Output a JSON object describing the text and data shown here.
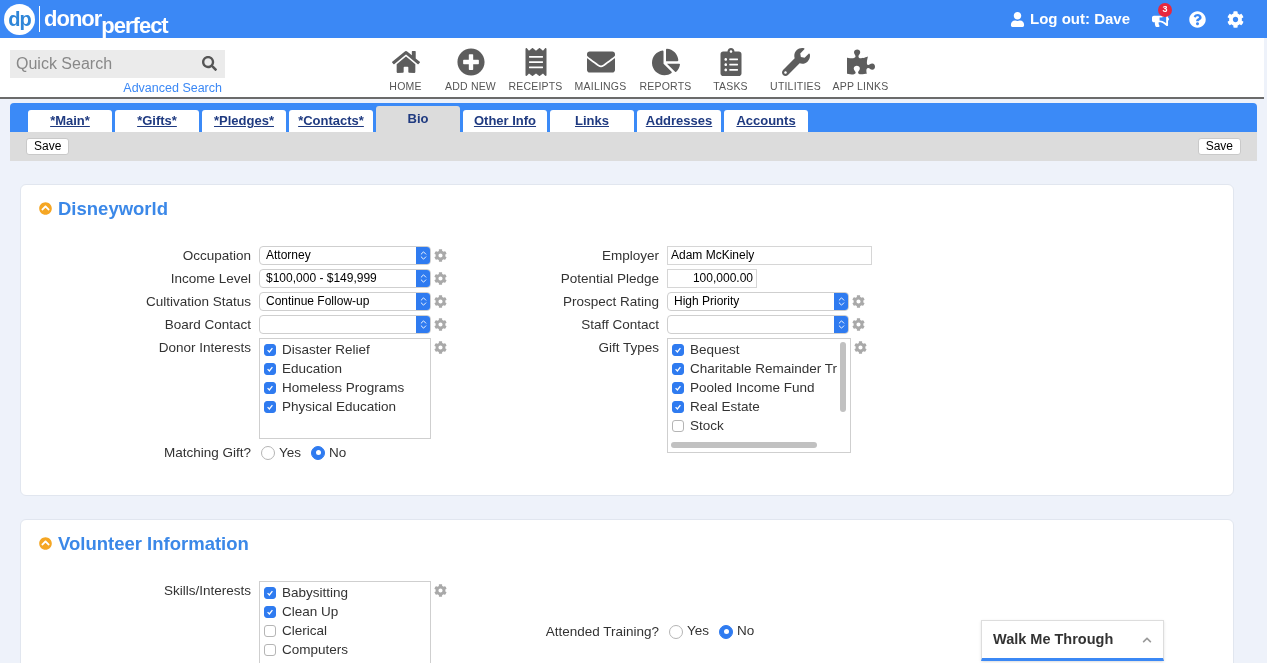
{
  "header": {
    "logo_mark": "dp",
    "logo_word_1": "donor",
    "logo_word_2": "perfect",
    "user": "Log out: Dave",
    "notification_count": "3"
  },
  "search": {
    "placeholder": "Quick Search",
    "advanced_link": "Advanced Search"
  },
  "nav": [
    "HOME",
    "ADD NEW",
    "RECEIPTS",
    "MAILINGS",
    "REPORTS",
    "TASKS",
    "UTILITIES",
    "APP LINKS"
  ],
  "tabs": [
    {
      "label": "*Main*",
      "selected": false
    },
    {
      "label": "*Gifts*",
      "selected": false
    },
    {
      "label": "*Pledges*",
      "selected": false
    },
    {
      "label": "*Contacts*",
      "selected": false
    },
    {
      "label": "Bio",
      "selected": true
    },
    {
      "label": "Other Info",
      "selected": false
    },
    {
      "label": "Links",
      "selected": false
    },
    {
      "label": "Addresses",
      "selected": false
    },
    {
      "label": "Accounts",
      "selected": false
    }
  ],
  "toolbar": {
    "save_left": "Save",
    "save_right": "Save"
  },
  "sections": [
    {
      "title": "Disneyworld",
      "expanded": true,
      "left": [
        {
          "kind": "select",
          "label": "Occupation",
          "value": "Attorney",
          "configurable": true
        },
        {
          "kind": "select",
          "label": "Income Level",
          "value": "$100,000 - $149,999",
          "configurable": true
        },
        {
          "kind": "select",
          "label": "Cultivation Status",
          "value": "Continue Follow-up",
          "configurable": true
        },
        {
          "kind": "select",
          "label": "Board Contact",
          "configurable": true
        },
        {
          "kind": "checklist",
          "label": "Donor Interests",
          "configurable": true,
          "scrollbars": false,
          "items": [
            {
              "label": "Disaster Relief",
              "checked": true
            },
            {
              "label": "Education",
              "checked": true
            },
            {
              "label": "Homeless Programs",
              "checked": true
            },
            {
              "label": "Physical Education",
              "checked": true
            }
          ]
        },
        {
          "kind": "radio",
          "label": "Matching Gift?",
          "options": [
            {
              "label": "Yes",
              "selected": false
            },
            {
              "label": "No",
              "selected": true
            }
          ]
        }
      ],
      "right": [
        {
          "kind": "text",
          "label": "Employer",
          "value": "Adam McKinely",
          "configurable": false
        },
        {
          "kind": "number",
          "label": "Potential Pledge",
          "value": "100,000.00",
          "configurable": false
        },
        {
          "kind": "select",
          "label": "Prospect Rating",
          "value": "High Priority",
          "configurable": true
        },
        {
          "kind": "select",
          "label": "Staff Contact",
          "configurable": true
        },
        {
          "kind": "checklist",
          "label": "Gift Types",
          "configurable": true,
          "scrollbars": true,
          "items": [
            {
              "label": "Bequest",
              "checked": true
            },
            {
              "label": "Charitable Remainder Tr",
              "checked": true
            },
            {
              "label": "Pooled Income Fund",
              "checked": true
            },
            {
              "label": "Real Estate",
              "checked": true
            },
            {
              "label": "Stock",
              "checked": false
            }
          ]
        }
      ]
    },
    {
      "title": "Volunteer Information",
      "expanded": true,
      "left": [
        {
          "kind": "checklist",
          "label": "Skills/Interests",
          "configurable": true,
          "scrollbars": false,
          "items": [
            {
              "label": "Babysitting",
              "checked": true
            },
            {
              "label": "Clean Up",
              "checked": true
            },
            {
              "label": "Clerical",
              "checked": false
            },
            {
              "label": "Computers",
              "checked": false
            }
          ]
        }
      ],
      "right": [
        {
          "kind": "radio",
          "label": "Attended Training?",
          "options": [
            {
              "label": "Yes",
              "selected": false
            },
            {
              "label": "No",
              "selected": true
            }
          ]
        }
      ]
    }
  ],
  "walkthrough": {
    "title": "Walk Me Through",
    "expanded": false
  }
}
